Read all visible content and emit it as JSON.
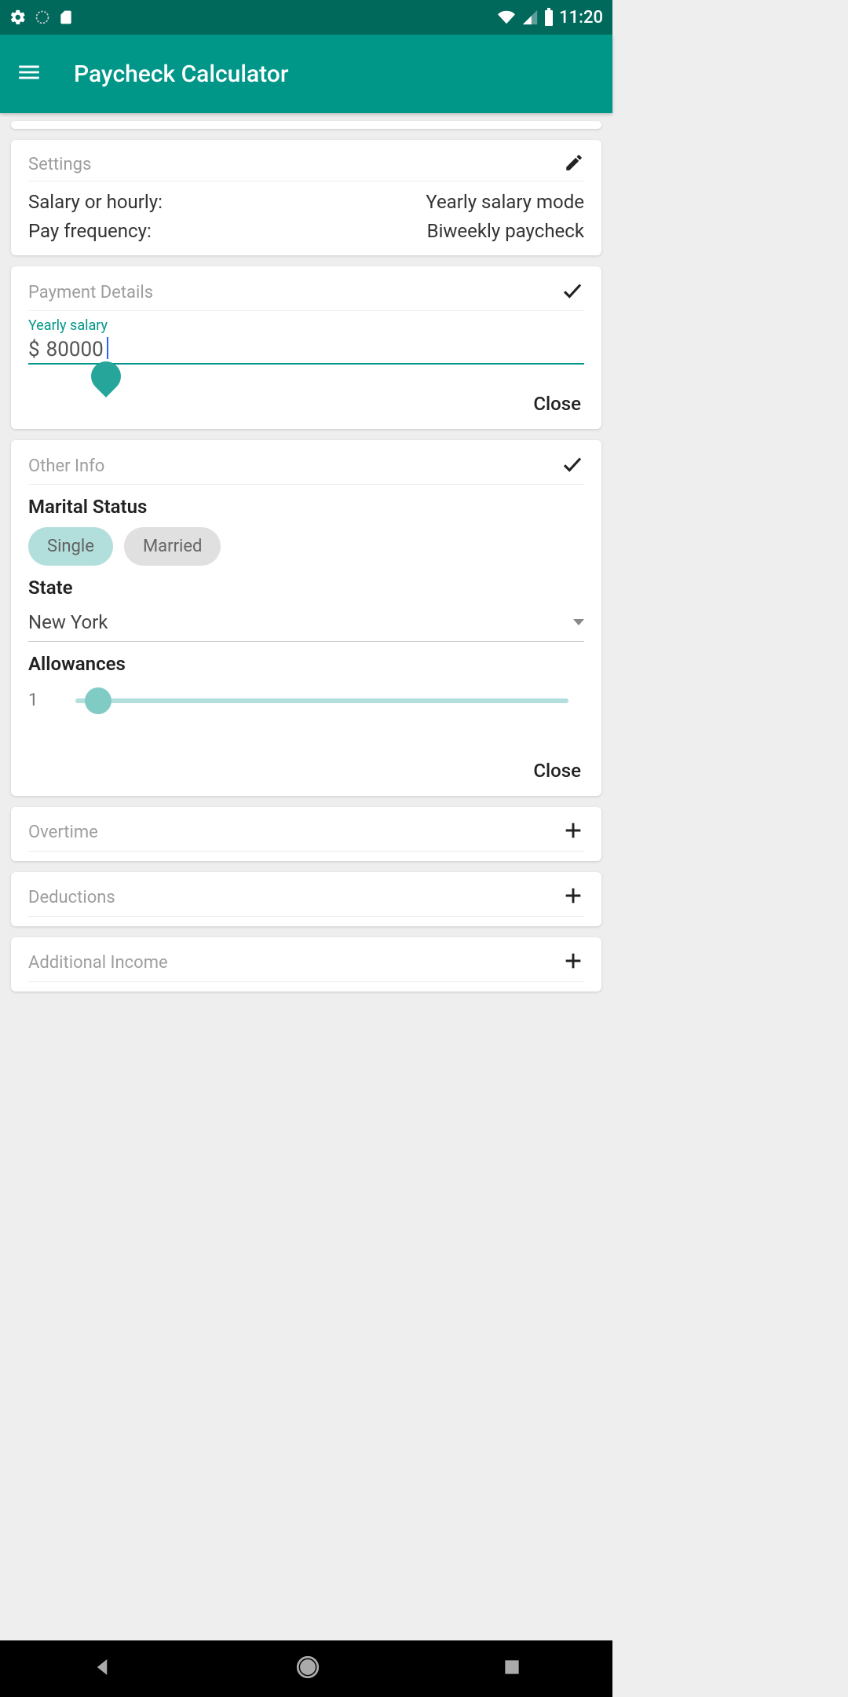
{
  "status": {
    "time": "11:20"
  },
  "app": {
    "title": "Paycheck Calculator"
  },
  "settings": {
    "title": "Settings",
    "salary_mode_label": "Salary or hourly:",
    "salary_mode_value": "Yearly salary mode",
    "frequency_label": "Pay frequency:",
    "frequency_value": "Biweekly paycheck"
  },
  "payment": {
    "title": "Payment Details",
    "salary_label": "Yearly salary",
    "currency": "$",
    "salary_value": "80000",
    "close": "Close"
  },
  "other": {
    "title": "Other Info",
    "marital_heading": "Marital Status",
    "chips": {
      "single": "Single",
      "married": "Married",
      "selected": "single"
    },
    "state_heading": "State",
    "state_value": "New York",
    "allowances_heading": "Allowances",
    "allowances_value": "1",
    "close": "Close"
  },
  "sections": {
    "overtime": "Overtime",
    "deductions": "Deductions",
    "additional_income": "Additional Income"
  }
}
